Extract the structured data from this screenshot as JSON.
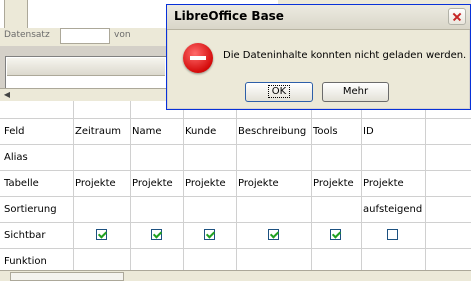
{
  "record_bar": {
    "label": "Datensatz",
    "value": "",
    "of_label": "von"
  },
  "dialog": {
    "title": "LibreOffice Base",
    "message": "Die Dateninhalte konnten nicht geladen werden.",
    "icon": "error-icon",
    "buttons": {
      "ok": "OK",
      "more": "Mehr"
    }
  },
  "query_grid": {
    "row_labels": [
      "Feld",
      "Alias",
      "Tabelle",
      "Sortierung",
      "Sichtbar",
      "Funktion"
    ],
    "columns": [
      {
        "field": "Zeitraum",
        "alias": "",
        "table": "Projekte",
        "sort": "",
        "visible": true
      },
      {
        "field": "Name",
        "alias": "",
        "table": "Projekte",
        "sort": "",
        "visible": true
      },
      {
        "field": "Kunde",
        "alias": "",
        "table": "Projekte",
        "sort": "",
        "visible": true
      },
      {
        "field": "Beschreibung",
        "alias": "",
        "table": "Projekte",
        "sort": "",
        "visible": true
      },
      {
        "field": "Tools",
        "alias": "",
        "table": "Projekte",
        "sort": "",
        "visible": true
      },
      {
        "field": "ID",
        "alias": "",
        "table": "Projekte",
        "sort": "aufsteigend",
        "visible": false
      }
    ]
  },
  "colors": {
    "checkmark": "#21a121",
    "error_red": "#d40b0b",
    "dialog_border": "#0831d9"
  }
}
